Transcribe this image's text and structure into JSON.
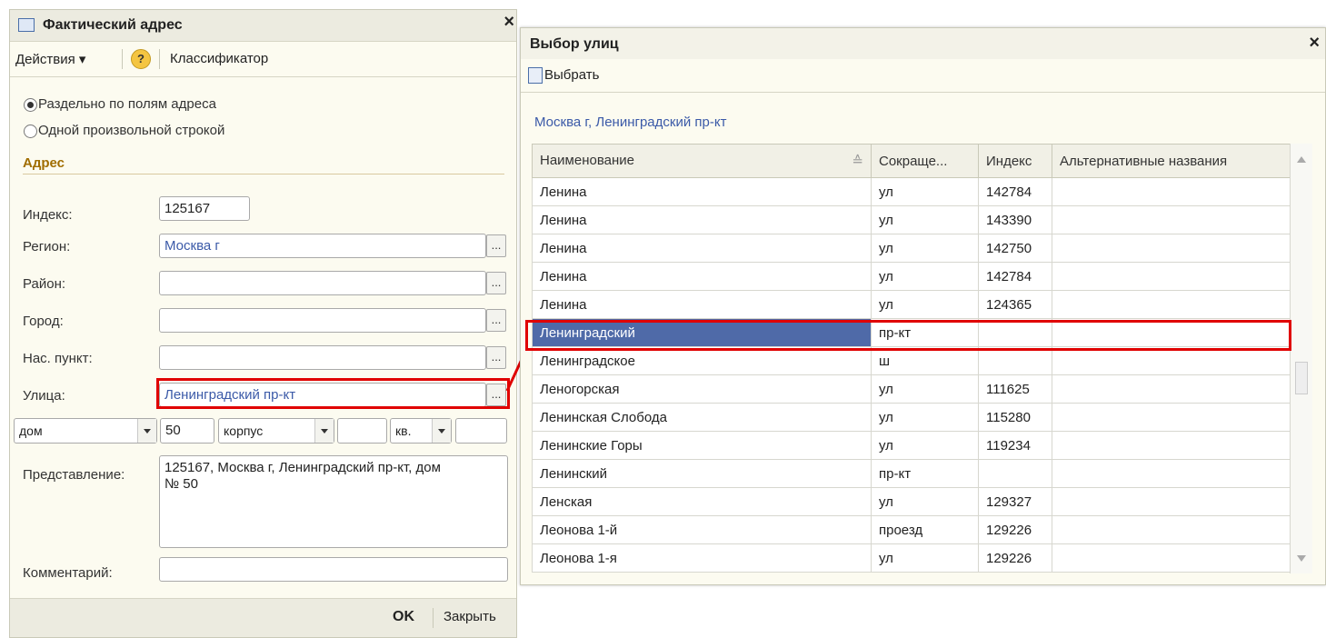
{
  "addr_dialog": {
    "title": "Фактический адрес",
    "close": "×",
    "actions_menu": "Действия ▾",
    "help": "?",
    "classifier": "Классификатор",
    "mode_fields": "Раздельно по полям адреса",
    "mode_string": "Одной произвольной строкой",
    "section": "Адрес",
    "index_label": "Индекс:",
    "index_value": "125167",
    "region_label": "Регион:",
    "region_value": "Москва г",
    "district_label": "Район:",
    "city_label": "Город:",
    "locality_label": "Нас. пункт:",
    "street_label": "Улица:",
    "street_value": "Ленинградский пр-кт",
    "house_type": "дом",
    "house_value": "50",
    "building_type": "корпус",
    "flat_type": "кв.",
    "presentation_label": "Представление:",
    "presentation_value": "125167, Москва г, Ленинградский пр-кт, дом № 50",
    "comment_label": "Комментарий:",
    "ok": "OK",
    "close_btn": "Закрыть",
    "dots": "..."
  },
  "street_dialog": {
    "title": "Выбор улиц",
    "close": "×",
    "select_btn": "Выбрать",
    "breadcrumb": "Москва г, Ленинградский пр-кт",
    "columns": [
      "Наименование",
      "Сокраще...",
      "Индекс",
      "Альтернативные названия"
    ],
    "rows": [
      [
        "Ленина",
        "ул",
        "142784",
        ""
      ],
      [
        "Ленина",
        "ул",
        "143390",
        ""
      ],
      [
        "Ленина",
        "ул",
        "142750",
        ""
      ],
      [
        "Ленина",
        "ул",
        "142784",
        ""
      ],
      [
        "Ленина",
        "ул",
        "124365",
        ""
      ],
      [
        "Ленинградский",
        "пр-кт",
        "",
        ""
      ],
      [
        "Ленинградское",
        "ш",
        "",
        ""
      ],
      [
        "Леногорская",
        "ул",
        "111625",
        ""
      ],
      [
        "Ленинская Слобода",
        "ул",
        "115280",
        ""
      ],
      [
        "Ленинские Горы",
        "ул",
        "119234",
        ""
      ],
      [
        "Ленинский",
        "пр-кт",
        "",
        ""
      ],
      [
        "Ленская",
        "ул",
        "129327",
        ""
      ],
      [
        "Леонова 1-й",
        "проезд",
        "129226",
        ""
      ],
      [
        "Леонова 1-я",
        "ул",
        "129226",
        ""
      ]
    ],
    "selected_row": 5
  },
  "colors": {
    "accent": "#e00000",
    "selection": "#4f6aa8",
    "link": "#3b5aa8",
    "section": "#a06d00"
  }
}
